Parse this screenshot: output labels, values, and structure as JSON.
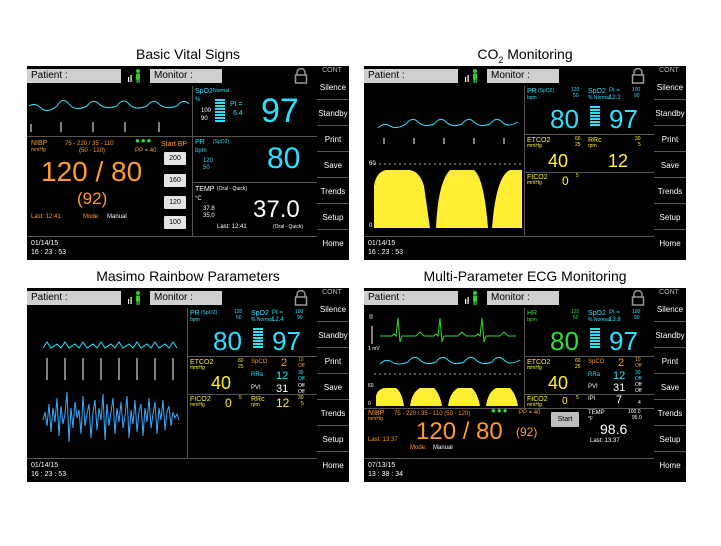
{
  "titles": {
    "p1": "Basic Vital Signs",
    "p2_prefix": "CO",
    "p2_sub": "2",
    "p2_suffix": " Monitoring",
    "p3": "Masimo Rainbow Parameters",
    "p4": "Multi-Parameter ECG Monitoring"
  },
  "common": {
    "patient_label": "Patient :",
    "monitor_label": "Monitor :",
    "cont": "CONT",
    "sidebar": [
      "Silence",
      "Standby",
      "Print",
      "Save",
      "Trends",
      "Setup",
      "Home"
    ],
    "colors": {
      "cyan": "#2ee0ff",
      "orange": "#ff9c2a",
      "yellow": "#ffee33",
      "green": "#33dd33"
    },
    "icons": [
      "person-icon",
      "lock-icon"
    ]
  },
  "p1": {
    "date": "01/14/15",
    "time": "16 : 23 : 53",
    "spo2_label": "SpO2",
    "spo2_sub": "Normal",
    "spo2_unit": "%",
    "spo2_hi": "100",
    "spo2_lo": "90",
    "pi_label": "PI =",
    "pi_val": "6.4",
    "spo2_value": "97",
    "pr_label": "PR",
    "pr_src": "(SpO2)",
    "pr_unit": "bpm",
    "pr_hi": "120",
    "pr_lo": "50",
    "pr_value": "80",
    "nibp_label": "NIBP",
    "nibp_unit": "mmHg",
    "nibp_limits": "75 - 220 / 35 - 110",
    "nibp_limits2": "(50 - 120)",
    "pp": "PP = 40",
    "start_bp": "Start BP",
    "nibp_value": "120 / 80",
    "nibp_mean": "(92)",
    "last": "Last: 12:41",
    "mode_label": "Mode:",
    "mode": "Manual",
    "bp_buttons": [
      "200",
      "160",
      "120",
      "100"
    ],
    "temp_label": "TEMP",
    "temp_src": "(Oral - Quick)",
    "temp_unit": "°C",
    "temp_hi": "37.8",
    "temp_lo": "35.0",
    "temp_value": "37.0",
    "temp_last": "Last: 12:41",
    "temp_src2": "(Oral - Quick)"
  },
  "p2": {
    "date": "01/14/15",
    "time": "16 : 23 : 53",
    "pr_label": "PR",
    "pr_src": "(SpO2)",
    "pr_unit": "bpm",
    "pr_hi": "120",
    "pr_lo": "50",
    "pr_value": "80",
    "spo2_label": "SpO2",
    "spo2_sub": "% Normal",
    "pi_label": "PI =",
    "pi_val": "12.2",
    "spo2_hi": "100",
    "spo2_lo": "90",
    "spo2_value": "97",
    "etco2_label": "ETCO2",
    "etco2_unit": "mmHg",
    "etco2_hi": "60",
    "etco2_lo": "25",
    "etco2_value": "40",
    "rrc_label": "RRc",
    "rrc_unit": "rpm",
    "rrc_hi": "30",
    "rrc_lo": "5",
    "rrc_value": "12",
    "fico2_label": "FICO2",
    "fico2_unit": "mmHg",
    "fico2_value": "0",
    "fico2_hi": "5",
    "co2_scale_top": "60",
    "co2_scale_bottom": "0"
  },
  "p3": {
    "date": "01/14/15",
    "time": "16 : 23 : 53",
    "pr_label": "PR",
    "pr_src": "(SpO2)",
    "pr_unit": "bpm",
    "pr_hi": "120",
    "pr_lo": "50",
    "pr_value": "80",
    "spo2_label": "SpO2",
    "spo2_sub": "% Normal",
    "pi_label": "PI =",
    "pi_val": "12.4",
    "spo2_hi": "100",
    "spo2_lo": "90",
    "spo2_value": "97",
    "etco2_label": "ETCO2",
    "etco2_unit": "mmHg",
    "etco2_hi": "60",
    "etco2_lo": "25",
    "etco2_value": "40",
    "fico2_label": "FICO2",
    "fico2_unit": "mmHg",
    "fico2_value": "0",
    "fico2_hi": "5",
    "spco_label": "SpCO",
    "spco_value": "2",
    "spco_hi": "10",
    "spco_lo": "Off",
    "rra_label": "RRa",
    "rra_value": "12",
    "rra_hi": "30",
    "rra_lo": "Off",
    "pvi_label": "PVI",
    "pvi_value": "31",
    "pvi_hi": "Off",
    "pvi_lo": "Off",
    "rrc_label": "RRc",
    "rrc_unit": "rpm",
    "rrc_value": "12",
    "rrc_hi": "30",
    "rrc_lo": "5"
  },
  "p4": {
    "date": "07/13/15",
    "time": "13 : 38 : 34",
    "ecg_scale": "1 mV",
    "ecg_lead": "II",
    "hr_label": "HR",
    "hr_unit": "bpm",
    "hr_hi": "120",
    "hr_lo": "50",
    "hr_value": "80",
    "spo2_label": "SpO2",
    "spo2_sub": "% Normal",
    "pi_label": "PI =",
    "pi_val": "13.8",
    "spo2_hi": "100",
    "spo2_lo": "90",
    "spo2_value": "97",
    "etco2_label": "ETCO2",
    "etco2_unit": "mmHg",
    "etco2_hi": "60",
    "etco2_lo": "25",
    "etco2_value": "40",
    "fico2_label": "FICO2",
    "fico2_unit": "mmHg",
    "fico2_value": "0",
    "fico2_hi": "5",
    "spco_label": "SpCO",
    "spco_value": "2",
    "spco_hi": "10",
    "spco_lo": "Off",
    "rra_label": "RRa",
    "rra_value": "12",
    "rra_hi": "30",
    "rra_lo": "Off",
    "pvi_label": "PVI",
    "pvi_value": "31",
    "pvi_hi": "Off",
    "pvi_lo": "Off",
    "ipi_label": "IPI",
    "ipi_value": "7",
    "ipi_lo": "4",
    "co2_scale_top": "60",
    "co2_scale_bottom": "0",
    "nibp_label": "NIBP",
    "nibp_unit": "mmHg",
    "nibp_limits": "75 - 220 / 35 - 110 (50 - 120)",
    "pp": "PP = 40",
    "start": "Start",
    "nibp_value": "120 / 80",
    "nibp_mean": "(92)",
    "last": "Last: 13:37",
    "mode_label": "Mode:",
    "mode": "Manual",
    "temp_label": "TEMP",
    "temp_unit": "°F",
    "temp_hi": "100.0",
    "temp_lo": "95.0",
    "temp_value": "98.6",
    "temp_last": "Last: 13:37"
  }
}
